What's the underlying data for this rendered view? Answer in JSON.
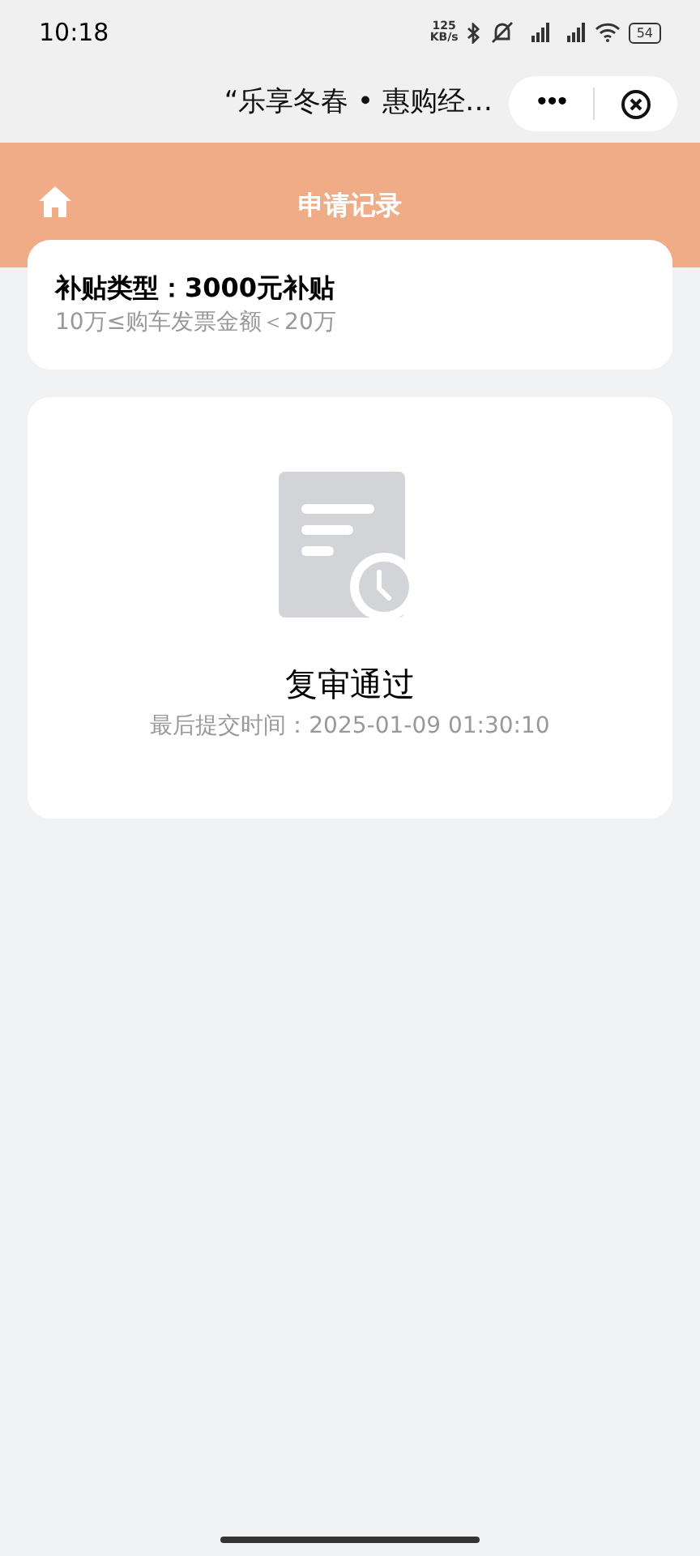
{
  "status_bar": {
    "time": "10:18",
    "speed": "125",
    "speed_unit": "KB/s",
    "battery": "54"
  },
  "title_bar": {
    "title": "“乐享冬春 • 惠购经…",
    "more": "•••"
  },
  "header": {
    "title": "申请记录"
  },
  "subsidy_card": {
    "title": "补贴类型：3000元补贴",
    "condition": "10万≤购车发票金额＜20万"
  },
  "status_card": {
    "status": "复审通过",
    "submitted": "最后提交时间：2025-01-09 01:30:10"
  }
}
